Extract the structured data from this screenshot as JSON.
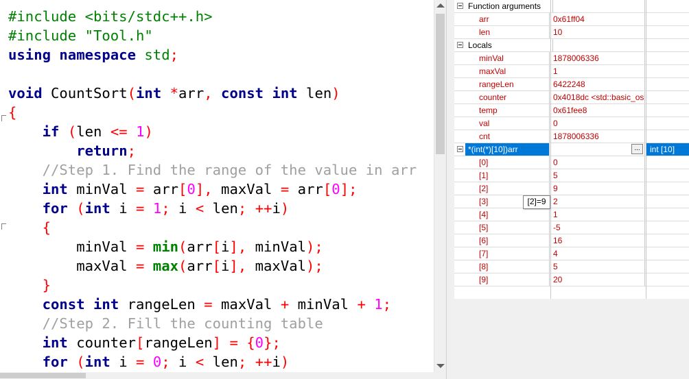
{
  "editor": {
    "lines": [
      [
        {
          "t": "#include <bits/stdc++.h>",
          "c": "pp"
        }
      ],
      [
        {
          "t": "#include \"Tool.h\"",
          "c": "pp"
        }
      ],
      [
        {
          "t": "using namespace",
          "c": "kw"
        },
        {
          "t": " "
        },
        {
          "t": "std",
          "c": "pp"
        },
        {
          "t": ";",
          "c": "op"
        }
      ],
      [],
      [
        {
          "t": "void",
          "c": "kw"
        },
        {
          "t": " CountSort"
        },
        {
          "t": "(",
          "c": "op"
        },
        {
          "t": "int",
          "c": "kw"
        },
        {
          "t": " "
        },
        {
          "t": "*",
          "c": "op"
        },
        {
          "t": "arr"
        },
        {
          "t": ",",
          "c": "op"
        },
        {
          "t": " "
        },
        {
          "t": "const",
          "c": "kw"
        },
        {
          "t": " "
        },
        {
          "t": "int",
          "c": "kw"
        },
        {
          "t": " len"
        },
        {
          "t": ")",
          "c": "op"
        }
      ],
      [
        {
          "t": "{",
          "c": "op"
        }
      ],
      [
        {
          "t": "    "
        },
        {
          "t": "if",
          "c": "kw"
        },
        {
          "t": " "
        },
        {
          "t": "(",
          "c": "op"
        },
        {
          "t": "len "
        },
        {
          "t": "<=",
          "c": "op"
        },
        {
          "t": " "
        },
        {
          "t": "1",
          "c": "num"
        },
        {
          "t": ")",
          "c": "op"
        }
      ],
      [
        {
          "t": "        "
        },
        {
          "t": "return",
          "c": "kw"
        },
        {
          "t": ";",
          "c": "op"
        }
      ],
      [
        {
          "t": "    "
        },
        {
          "t": "//Step 1. Find the range of the value in arr",
          "c": "cm"
        }
      ],
      [
        {
          "t": "    "
        },
        {
          "t": "int",
          "c": "kw"
        },
        {
          "t": " minVal "
        },
        {
          "t": "=",
          "c": "op"
        },
        {
          "t": " arr"
        },
        {
          "t": "[",
          "c": "op"
        },
        {
          "t": "0",
          "c": "num"
        },
        {
          "t": "],",
          "c": "op"
        },
        {
          "t": " maxVal "
        },
        {
          "t": "=",
          "c": "op"
        },
        {
          "t": " arr"
        },
        {
          "t": "[",
          "c": "op"
        },
        {
          "t": "0",
          "c": "num"
        },
        {
          "t": "];",
          "c": "op"
        }
      ],
      [
        {
          "t": "    "
        },
        {
          "t": "for",
          "c": "kw"
        },
        {
          "t": " "
        },
        {
          "t": "(",
          "c": "op"
        },
        {
          "t": "int",
          "c": "kw"
        },
        {
          "t": " i "
        },
        {
          "t": "=",
          "c": "op"
        },
        {
          "t": " "
        },
        {
          "t": "1",
          "c": "num"
        },
        {
          "t": ";",
          "c": "op"
        },
        {
          "t": " i "
        },
        {
          "t": "<",
          "c": "op"
        },
        {
          "t": " len"
        },
        {
          "t": ";",
          "c": "op"
        },
        {
          "t": " "
        },
        {
          "t": "++",
          "c": "op"
        },
        {
          "t": "i"
        },
        {
          "t": ")",
          "c": "op"
        }
      ],
      [
        {
          "t": "    "
        },
        {
          "t": "{",
          "c": "op"
        }
      ],
      [
        {
          "t": "        minVal "
        },
        {
          "t": "=",
          "c": "op"
        },
        {
          "t": " "
        },
        {
          "t": "min",
          "c": "fn"
        },
        {
          "t": "(",
          "c": "op"
        },
        {
          "t": "arr"
        },
        {
          "t": "[",
          "c": "op"
        },
        {
          "t": "i"
        },
        {
          "t": "],",
          "c": "op"
        },
        {
          "t": " minVal"
        },
        {
          "t": ");",
          "c": "op"
        }
      ],
      [
        {
          "t": "        maxVal "
        },
        {
          "t": "=",
          "c": "op"
        },
        {
          "t": " "
        },
        {
          "t": "max",
          "c": "fn"
        },
        {
          "t": "(",
          "c": "op"
        },
        {
          "t": "arr"
        },
        {
          "t": "[",
          "c": "op"
        },
        {
          "t": "i"
        },
        {
          "t": "],",
          "c": "op"
        },
        {
          "t": " maxVal"
        },
        {
          "t": ");",
          "c": "op"
        }
      ],
      [
        {
          "t": "    "
        },
        {
          "t": "}",
          "c": "op"
        }
      ],
      [
        {
          "t": "    "
        },
        {
          "t": "const",
          "c": "kw"
        },
        {
          "t": " "
        },
        {
          "t": "int",
          "c": "kw"
        },
        {
          "t": " rangeLen "
        },
        {
          "t": "=",
          "c": "op"
        },
        {
          "t": " maxVal "
        },
        {
          "t": "+",
          "c": "op"
        },
        {
          "t": " minVal "
        },
        {
          "t": "+",
          "c": "op"
        },
        {
          "t": " "
        },
        {
          "t": "1",
          "c": "num"
        },
        {
          "t": ";",
          "c": "op"
        }
      ],
      [
        {
          "t": "    "
        },
        {
          "t": "//Step 2. Fill the counting table",
          "c": "cm"
        }
      ],
      [
        {
          "t": "    "
        },
        {
          "t": "int",
          "c": "kw"
        },
        {
          "t": " counter"
        },
        {
          "t": "[",
          "c": "op"
        },
        {
          "t": "rangeLen"
        },
        {
          "t": "]",
          "c": "op"
        },
        {
          "t": " "
        },
        {
          "t": "=",
          "c": "op"
        },
        {
          "t": " "
        },
        {
          "t": "{",
          "c": "op"
        },
        {
          "t": "0",
          "c": "num"
        },
        {
          "t": "};",
          "c": "op"
        }
      ],
      [
        {
          "t": "    "
        },
        {
          "t": "for",
          "c": "kw"
        },
        {
          "t": " "
        },
        {
          "t": "(",
          "c": "op"
        },
        {
          "t": "int",
          "c": "kw"
        },
        {
          "t": " i "
        },
        {
          "t": "=",
          "c": "op"
        },
        {
          "t": " "
        },
        {
          "t": "0",
          "c": "num"
        },
        {
          "t": ";",
          "c": "op"
        },
        {
          "t": " i "
        },
        {
          "t": "<",
          "c": "op"
        },
        {
          "t": " len"
        },
        {
          "t": ";",
          "c": "op"
        },
        {
          "t": " "
        },
        {
          "t": "++",
          "c": "op"
        },
        {
          "t": "i"
        },
        {
          "t": ")",
          "c": "op"
        }
      ]
    ]
  },
  "watches": {
    "rows": [
      {
        "kind": "group",
        "name": "Function arguments",
        "value": "",
        "type": ""
      },
      {
        "kind": "item",
        "name": "arr",
        "value": "0x61ff04",
        "type": ""
      },
      {
        "kind": "item",
        "name": "len",
        "value": "10",
        "type": ""
      },
      {
        "kind": "group",
        "name": "Locals",
        "value": "",
        "type": ""
      },
      {
        "kind": "item",
        "name": "minVal",
        "value": "1878006336",
        "type": ""
      },
      {
        "kind": "item",
        "name": "maxVal",
        "value": "1",
        "type": ""
      },
      {
        "kind": "item",
        "name": "rangeLen",
        "value": "6422248",
        "type": ""
      },
      {
        "kind": "item",
        "name": "counter",
        "value": "0x4018dc <std::basic_os",
        "type": ""
      },
      {
        "kind": "item",
        "name": "temp",
        "value": "0x61fee8",
        "type": ""
      },
      {
        "kind": "item",
        "name": "val",
        "value": "0",
        "type": ""
      },
      {
        "kind": "item",
        "name": "cnt",
        "value": "1878006336",
        "type": ""
      },
      {
        "kind": "selected",
        "name": "*(int(*)[10])arr",
        "value": "",
        "type": "int [10]"
      },
      {
        "kind": "item",
        "name": "[0]",
        "value": "0",
        "type": ""
      },
      {
        "kind": "item",
        "name": "[1]",
        "value": "5",
        "type": ""
      },
      {
        "kind": "item",
        "name": "[2]",
        "value": "9",
        "type": ""
      },
      {
        "kind": "item",
        "name": "[3]",
        "value": "2",
        "type": ""
      },
      {
        "kind": "item",
        "name": "[4]",
        "value": "1",
        "type": ""
      },
      {
        "kind": "item",
        "name": "[5]",
        "value": "-5",
        "type": ""
      },
      {
        "kind": "item",
        "name": "[6]",
        "value": "16",
        "type": ""
      },
      {
        "kind": "item",
        "name": "[7]",
        "value": "4",
        "type": ""
      },
      {
        "kind": "item",
        "name": "[8]",
        "value": "5",
        "type": ""
      },
      {
        "kind": "item",
        "name": "[9]",
        "value": "20",
        "type": ""
      }
    ],
    "ellipsis_label": "...",
    "tooltip": "[2]=9"
  }
}
